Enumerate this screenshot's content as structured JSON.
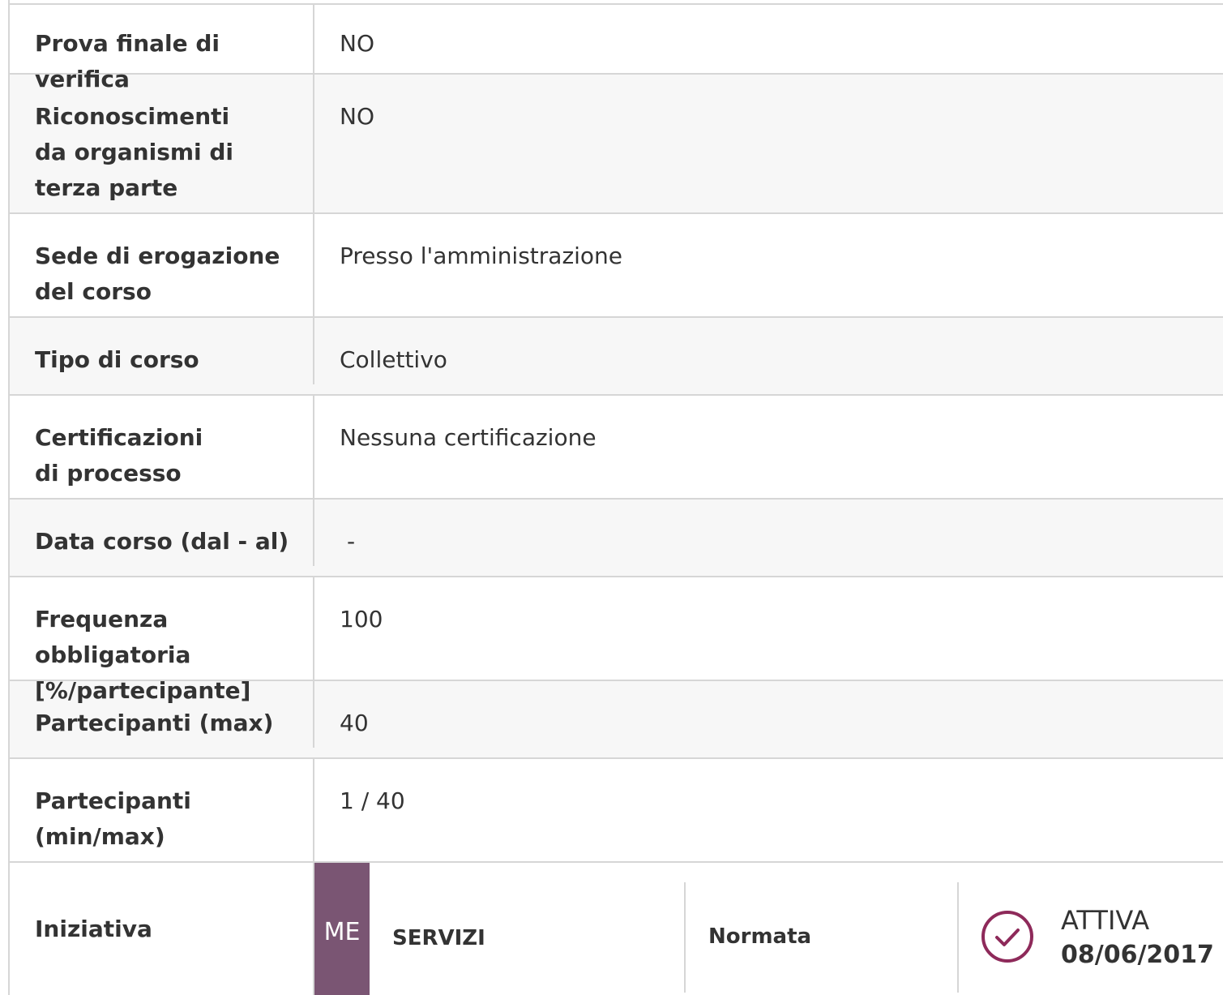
{
  "rows": [
    {
      "label": "Prova finale di verifica",
      "value": "NO"
    },
    {
      "label": "Riconoscimenti da organismi di terza parte",
      "value": "NO"
    },
    {
      "label": "Sede di erogazione del corso",
      "value": "Presso l'amministrazione"
    },
    {
      "label": "Tipo di corso",
      "value": "Collettivo"
    },
    {
      "label": "Certificazioni di processo",
      "value": "Nessuna certificazione"
    },
    {
      "label": "Data corso (dal - al)",
      "value": "-"
    },
    {
      "label": "Frequenza obbligatoria [%/partecipante]",
      "value": "100"
    },
    {
      "label": "Partecipanti (max)",
      "value": "40"
    },
    {
      "label": "Partecipanti (min/max)",
      "value": "1 / 40"
    }
  ],
  "iniziativa": {
    "label": "Iniziativa",
    "code": "ME",
    "category": "SERVIZI",
    "type": "Normata",
    "status": "ATTIVA",
    "date": "08/06/2017",
    "accent_color": "#7a5573"
  }
}
